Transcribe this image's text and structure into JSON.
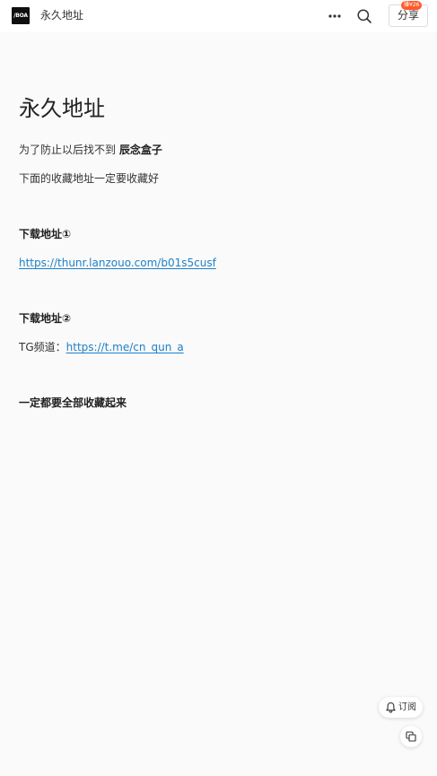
{
  "header": {
    "logo_text": "/BOA",
    "site_title": "永久地址",
    "share_label": "分享",
    "share_badge": "赚¥26",
    "icons": [
      "more-icon",
      "search-icon"
    ]
  },
  "article": {
    "title": "永久地址",
    "intro_prefix": "为了防止以后找不到 ",
    "intro_bold": "辰念盒子",
    "line2": "下面的收藏地址一定要收藏好",
    "section1_heading": "下载地址①",
    "section1_link": "https://thunr.lanzouo.com/b01s5cusf",
    "section2_heading": "下载地址②",
    "section2_prefix": "TG频道：",
    "section2_link": "https://t.me/cn_qun_a",
    "footer_bold": "一定都要全部收藏起来"
  },
  "floating": {
    "subscribe_label": "订阅",
    "icons": [
      "bell-icon",
      "copy-icon"
    ]
  },
  "colors": {
    "background": "#fafafa",
    "link": "#1e80c8",
    "badge": "#ff5a2b"
  }
}
